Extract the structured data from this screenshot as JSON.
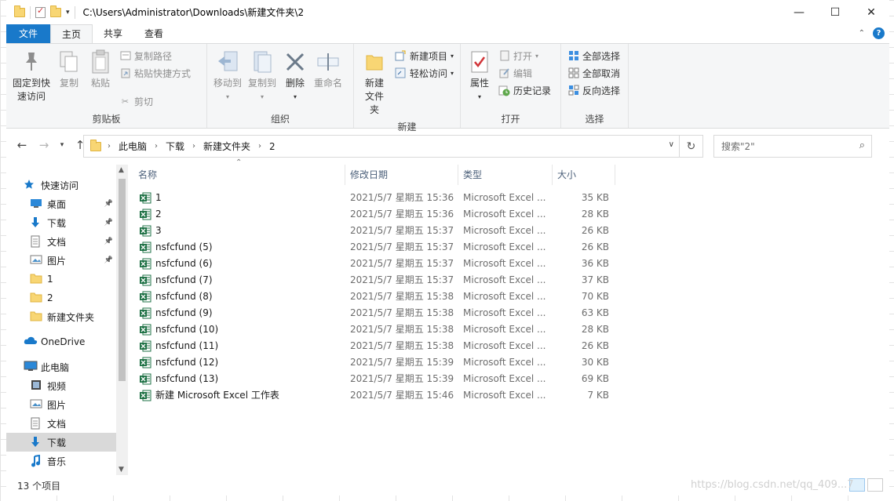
{
  "title": {
    "path": "C:\\Users\\Administrator\\Downloads\\新建文件夹\\2"
  },
  "window_controls": {
    "minimize": "—",
    "maximize": "☐",
    "close": "✕"
  },
  "tabs": [
    "文件",
    "主页",
    "共享",
    "查看"
  ],
  "ribbon": {
    "clipboard": {
      "label": "剪贴板",
      "pin": "固定到快\n速访问",
      "pin_l1": "固定到快",
      "pin_l2": "速访问",
      "copy": "复制",
      "paste": "粘贴",
      "copy_path": "复制路径",
      "paste_shortcut": "粘贴快捷方式",
      "cut": "剪切"
    },
    "organize": {
      "label": "组织",
      "move_to": "移动到",
      "copy_to": "复制到",
      "delete": "删除",
      "rename": "重命名"
    },
    "new": {
      "label": "新建",
      "new_folder_l1": "新建",
      "new_folder_l2": "文件夹",
      "new_item": "新建项目",
      "easy_access": "轻松访问"
    },
    "open": {
      "label": "打开",
      "properties": "属性",
      "open": "打开",
      "edit": "编辑",
      "history": "历史记录"
    },
    "select": {
      "label": "选择",
      "select_all": "全部选择",
      "select_none": "全部取消",
      "invert": "反向选择"
    }
  },
  "address": {
    "crumbs": [
      "此电脑",
      "下载",
      "新建文件夹",
      "2"
    ],
    "search_placeholder": "搜索\"2\""
  },
  "nav": [
    {
      "label": "快速访问",
      "icon": "star-icon"
    },
    {
      "label": "桌面",
      "icon": "desktop-icon",
      "pinned": true
    },
    {
      "label": "下载",
      "icon": "download-icon",
      "pinned": true
    },
    {
      "label": "文档",
      "icon": "document-icon",
      "pinned": true
    },
    {
      "label": "图片",
      "icon": "picture-icon",
      "pinned": true
    },
    {
      "label": "1",
      "icon": "folder-icon"
    },
    {
      "label": "2",
      "icon": "folder-icon"
    },
    {
      "label": "新建文件夹",
      "icon": "folder-icon"
    },
    {
      "label": "OneDrive",
      "icon": "cloud-icon"
    },
    {
      "label": "此电脑",
      "icon": "computer-icon"
    },
    {
      "label": "视频",
      "icon": "video-icon"
    },
    {
      "label": "图片",
      "icon": "picture-icon"
    },
    {
      "label": "文档",
      "icon": "document-icon"
    },
    {
      "label": "下载",
      "icon": "download-icon",
      "selected": true
    },
    {
      "label": "音乐",
      "icon": "music-icon"
    }
  ],
  "columns": [
    "名称",
    "修改日期",
    "类型",
    "大小"
  ],
  "files": [
    {
      "name": "1",
      "date": "2021/5/7 星期五 15:36",
      "type": "Microsoft Excel ...",
      "size": "35 KB"
    },
    {
      "name": "2",
      "date": "2021/5/7 星期五 15:36",
      "type": "Microsoft Excel ...",
      "size": "28 KB"
    },
    {
      "name": "3",
      "date": "2021/5/7 星期五 15:37",
      "type": "Microsoft Excel ...",
      "size": "26 KB"
    },
    {
      "name": "nsfcfund (5)",
      "date": "2021/5/7 星期五 15:37",
      "type": "Microsoft Excel ...",
      "size": "26 KB"
    },
    {
      "name": "nsfcfund (6)",
      "date": "2021/5/7 星期五 15:37",
      "type": "Microsoft Excel ...",
      "size": "36 KB"
    },
    {
      "name": "nsfcfund (7)",
      "date": "2021/5/7 星期五 15:37",
      "type": "Microsoft Excel ...",
      "size": "37 KB"
    },
    {
      "name": "nsfcfund (8)",
      "date": "2021/5/7 星期五 15:38",
      "type": "Microsoft Excel ...",
      "size": "70 KB"
    },
    {
      "name": "nsfcfund (9)",
      "date": "2021/5/7 星期五 15:38",
      "type": "Microsoft Excel ...",
      "size": "63 KB"
    },
    {
      "name": "nsfcfund (10)",
      "date": "2021/5/7 星期五 15:38",
      "type": "Microsoft Excel ...",
      "size": "28 KB"
    },
    {
      "name": "nsfcfund (11)",
      "date": "2021/5/7 星期五 15:38",
      "type": "Microsoft Excel ...",
      "size": "26 KB"
    },
    {
      "name": "nsfcfund (12)",
      "date": "2021/5/7 星期五 15:39",
      "type": "Microsoft Excel ...",
      "size": "30 KB"
    },
    {
      "name": "nsfcfund (13)",
      "date": "2021/5/7 星期五 15:39",
      "type": "Microsoft Excel ...",
      "size": "69 KB"
    },
    {
      "name": "新建 Microsoft Excel 工作表",
      "date": "2021/5/7 星期五 15:46",
      "type": "Microsoft Excel ...",
      "size": "7 KB"
    }
  ],
  "status": {
    "count": "13 个项目"
  },
  "watermark": "https://blog.csdn.net/qq_409...7",
  "colors": {
    "accent": "#1979ca",
    "excel": "#1e7145",
    "folder": "#f8d674"
  }
}
